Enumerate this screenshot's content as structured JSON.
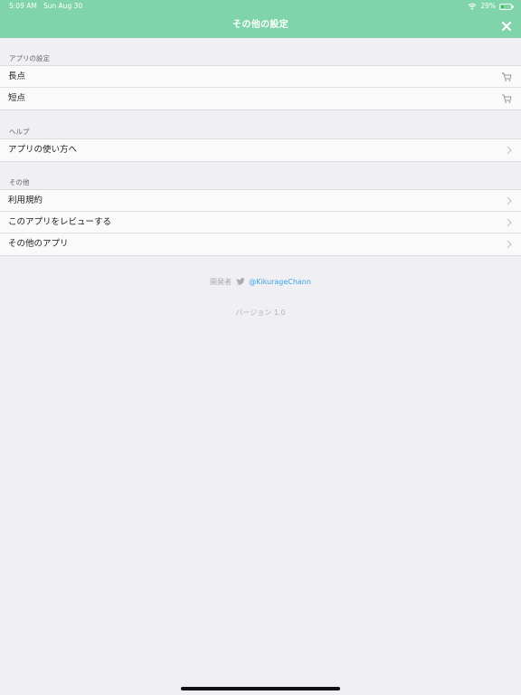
{
  "status_bar": {
    "time": "5:09 AM",
    "date": "Sun Aug 30",
    "battery": "29%"
  },
  "nav": {
    "title": "その他の設定"
  },
  "sections": [
    {
      "header": "アプリの設定",
      "items": [
        {
          "label": "長点"
        },
        {
          "label": "短点"
        }
      ]
    },
    {
      "header": "ヘルプ",
      "items": [
        {
          "label": "アプリの使い方へ"
        }
      ]
    },
    {
      "header": "その他",
      "items": [
        {
          "label": "利用規約"
        },
        {
          "label": "このアプリをレビューする"
        },
        {
          "label": "その他のアプリ"
        }
      ]
    }
  ],
  "footer": {
    "developer_label": "開発者",
    "handle": "@KikurageChann",
    "version": "バージョン 1.0"
  },
  "colors": {
    "accent": "#80d4ab",
    "link": "#3da3e0",
    "background": "#efeff4"
  }
}
